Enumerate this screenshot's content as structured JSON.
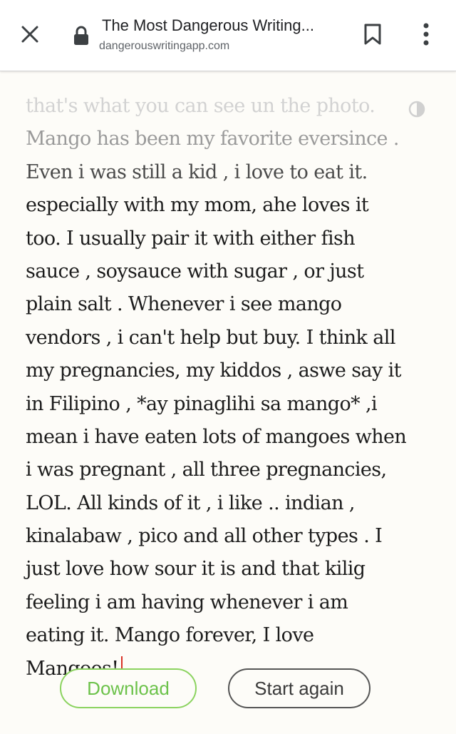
{
  "browser": {
    "page_title": "The Most Dangerous Writing...",
    "url": "dangerouswritingapp.com",
    "icons": {
      "close": "close-icon",
      "lock": "lock-icon",
      "bookmark": "bookmark-icon",
      "menu": "more-vert-icon"
    }
  },
  "editor": {
    "lines": [
      "that's what you can see un the photo.",
      "Mango has been my favorite eversince .",
      "Even i was still a kid , i love to eat it.",
      "especially with my mom, ahe loves it",
      "too. I usually pair it with either  fish",
      "sauce , soysauce with sugar , or just",
      "plain salt . Whenever i see mango",
      "vendors , i can't help but buy.  I think all",
      "my pregnancies, my kiddos , aswe say it",
      "in Filipino , *ay pinaglihi sa mango* ,i",
      "mean i have eaten lots of mangoes when",
      "i was pregnant , all three pregnancies,",
      "LOL. All kinds of it , i like .. indian ,",
      "kinalabaw , pico and all other types . I",
      "just love how sour it is and that kilig",
      "feeling i am having whenever i am",
      "eating it. Mango forever, I love",
      "Mangoes!"
    ],
    "contrast_icon": "contrast-icon"
  },
  "actions": {
    "download_label": "Download",
    "start_again_label": "Start again"
  },
  "colors": {
    "download_accent": "#8bd35f",
    "cursor": "#d93025",
    "background": "#fdfcf8"
  }
}
